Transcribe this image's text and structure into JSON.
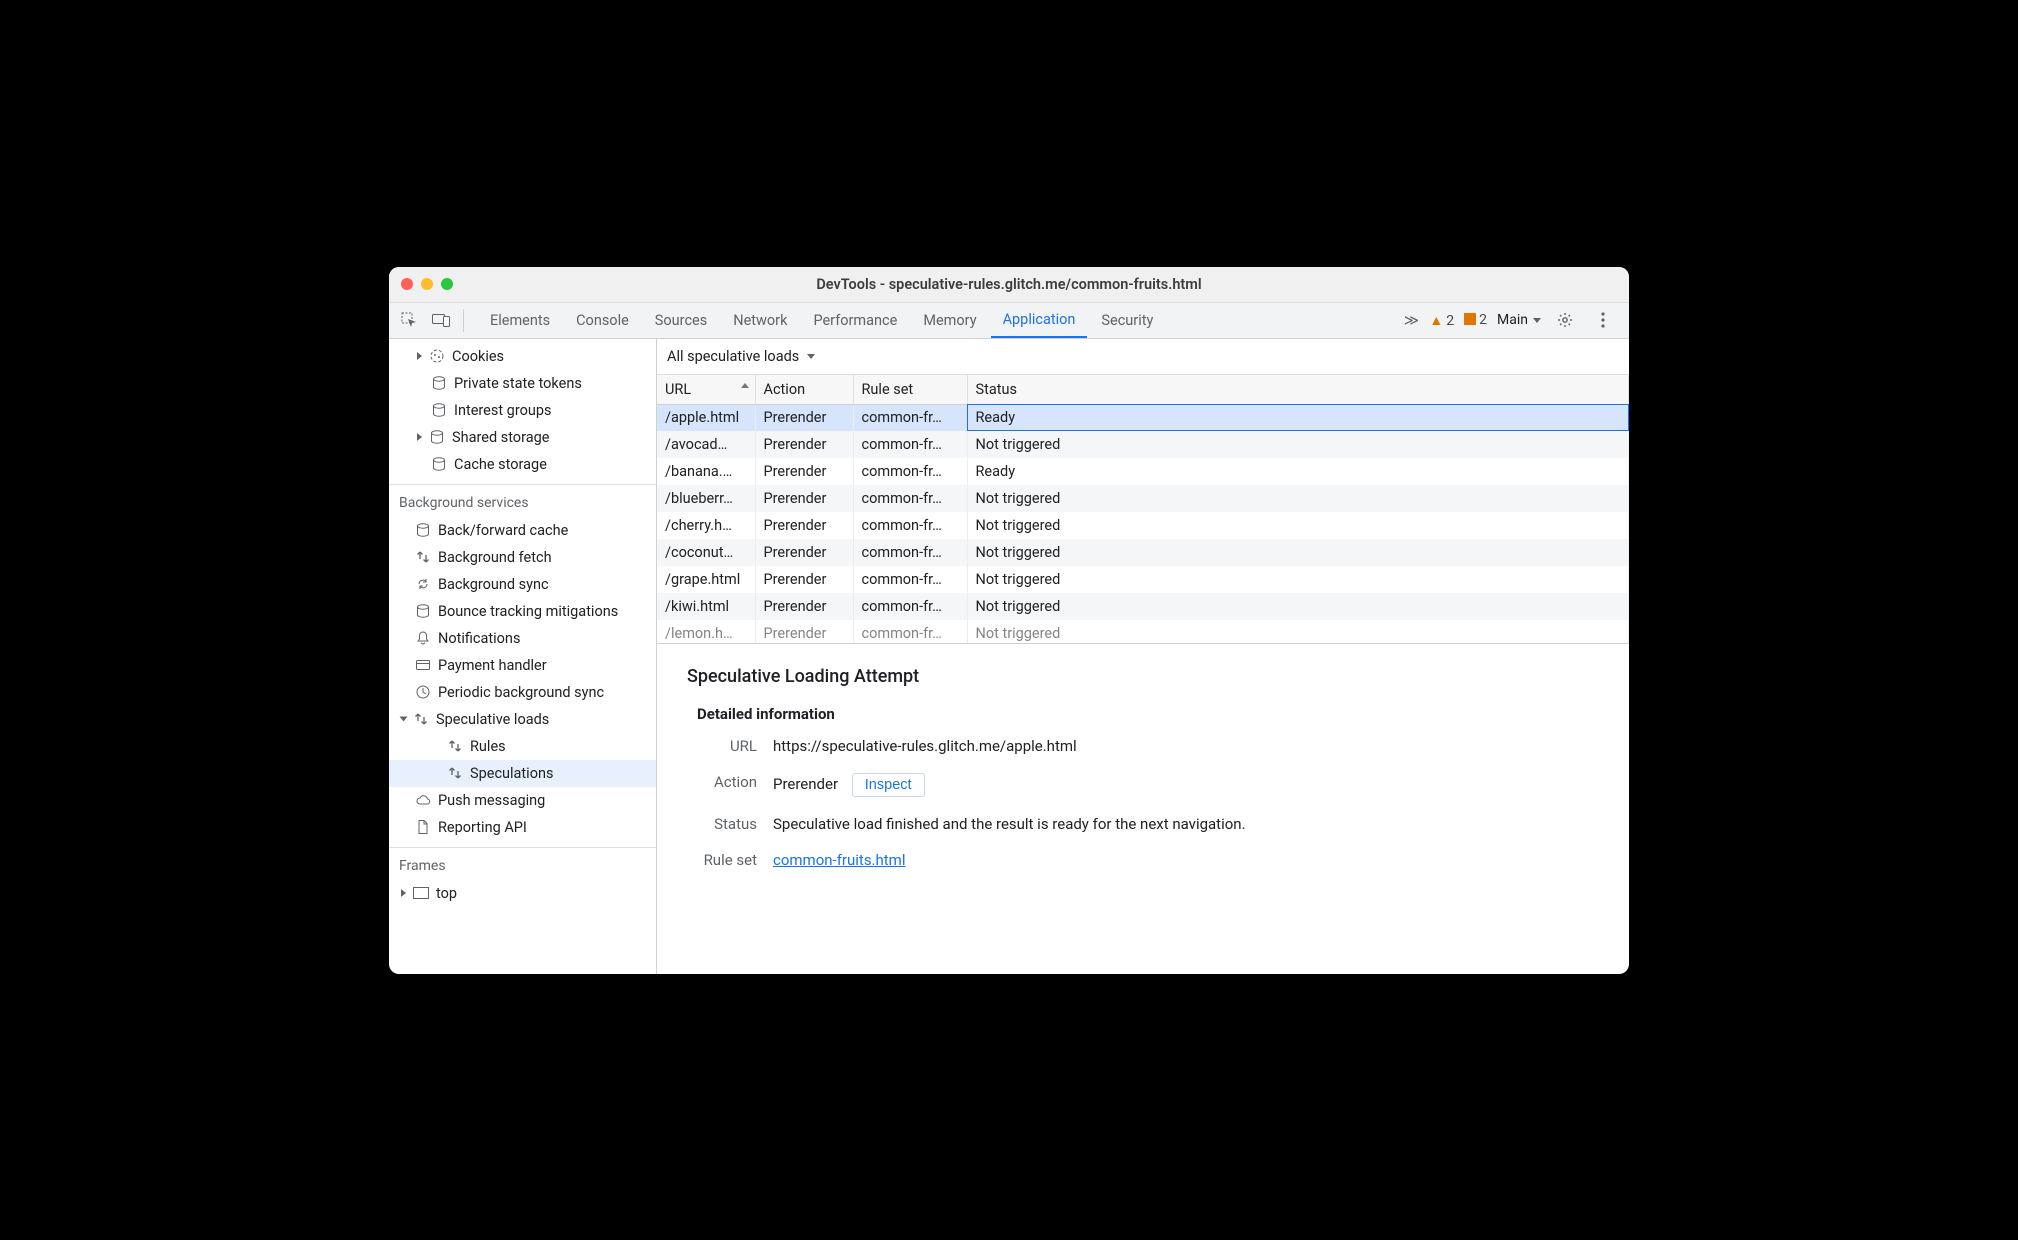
{
  "window": {
    "title": "DevTools - speculative-rules.glitch.me/common-fruits.html"
  },
  "tabs": {
    "items": [
      "Elements",
      "Console",
      "Sources",
      "Network",
      "Performance",
      "Memory",
      "Application",
      "Security"
    ],
    "active_index": 6,
    "more_glyph": "≫",
    "warnings": "2",
    "issues": "2",
    "target_label": "Main"
  },
  "sidebar": {
    "storage": [
      {
        "label": "Cookies",
        "icon": "cookie",
        "arrow": true
      },
      {
        "label": "Private state tokens",
        "icon": "db"
      },
      {
        "label": "Interest groups",
        "icon": "db"
      },
      {
        "label": "Shared storage",
        "icon": "db",
        "arrow": true
      },
      {
        "label": "Cache storage",
        "icon": "db"
      }
    ],
    "bg_heading": "Background services",
    "bg": [
      {
        "label": "Back/forward cache",
        "icon": "db"
      },
      {
        "label": "Background fetch",
        "icon": "updown"
      },
      {
        "label": "Background sync",
        "icon": "sync"
      },
      {
        "label": "Bounce tracking mitigations",
        "icon": "db"
      },
      {
        "label": "Notifications",
        "icon": "bell"
      },
      {
        "label": "Payment handler",
        "icon": "card"
      },
      {
        "label": "Periodic background sync",
        "icon": "clock"
      },
      {
        "label": "Speculative loads",
        "icon": "updown",
        "arrow": "down",
        "children": [
          {
            "label": "Rules",
            "icon": "updown"
          },
          {
            "label": "Speculations",
            "icon": "updown",
            "selected": true
          }
        ]
      },
      {
        "label": "Push messaging",
        "icon": "cloud"
      },
      {
        "label": "Reporting API",
        "icon": "doc"
      }
    ],
    "frames_heading": "Frames",
    "frames": {
      "label": "top",
      "icon": "frame"
    }
  },
  "filter": {
    "label": "All speculative loads"
  },
  "table": {
    "headers": {
      "url": "URL",
      "action": "Action",
      "ruleset": "Rule set",
      "status": "Status"
    },
    "rows": [
      {
        "url": "/apple.html",
        "action": "Prerender",
        "ruleset": "common-fr…",
        "status": "Ready",
        "selected": true
      },
      {
        "url": "/avocad…",
        "action": "Prerender",
        "ruleset": "common-fr…",
        "status": "Not triggered"
      },
      {
        "url": "/banana.…",
        "action": "Prerender",
        "ruleset": "common-fr…",
        "status": "Ready"
      },
      {
        "url": "/blueberr…",
        "action": "Prerender",
        "ruleset": "common-fr…",
        "status": "Not triggered"
      },
      {
        "url": "/cherry.h…",
        "action": "Prerender",
        "ruleset": "common-fr…",
        "status": "Not triggered"
      },
      {
        "url": "/coconut…",
        "action": "Prerender",
        "ruleset": "common-fr…",
        "status": "Not triggered"
      },
      {
        "url": "/grape.html",
        "action": "Prerender",
        "ruleset": "common-fr…",
        "status": "Not triggered"
      },
      {
        "url": "/kiwi.html",
        "action": "Prerender",
        "ruleset": "common-fr…",
        "status": "Not triggered"
      },
      {
        "url": "/lemon.h…",
        "action": "Prerender",
        "ruleset": "common-fr…",
        "status": "Not triggered",
        "cut": true
      }
    ]
  },
  "details": {
    "title": "Speculative Loading Attempt",
    "section": "Detailed information",
    "url_label": "URL",
    "url": "https://speculative-rules.glitch.me/apple.html",
    "action_label": "Action",
    "action": "Prerender",
    "inspect": "Inspect",
    "status_label": "Status",
    "status": "Speculative load finished and the result is ready for the next navigation.",
    "ruleset_label": "Rule set",
    "ruleset": "common-fruits.html"
  }
}
